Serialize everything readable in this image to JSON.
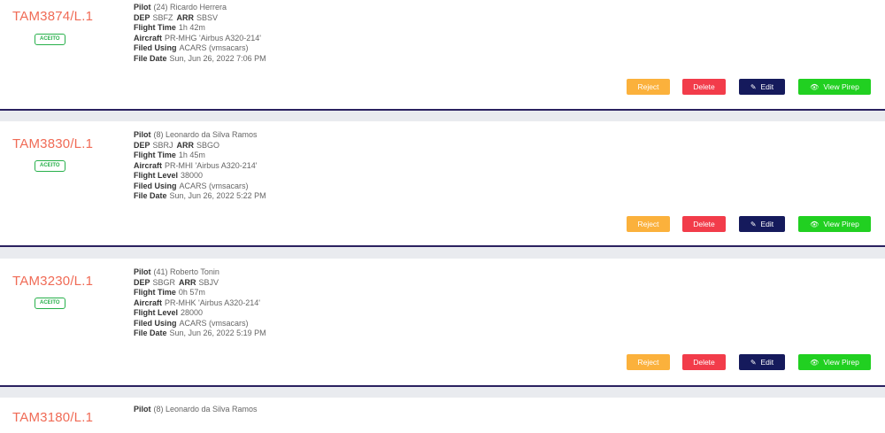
{
  "pireps": [
    {
      "flight_id": "TAM3874/L.1",
      "status": "ACEITO",
      "pilot_label": "Pilot",
      "pilot": "(24) Ricardo Herrera",
      "dep_label": "DEP",
      "dep": "SBFZ",
      "arr_label": "ARR",
      "arr": "SBSV",
      "flight_time_label": "Flight Time",
      "flight_time": "1h 42m",
      "aircraft_label": "Aircraft",
      "aircraft": "PR-MHG 'Airbus A320-214'",
      "filed_using_label": "Filed Using",
      "filed_using": "ACARS (vmsacars)",
      "file_date_label": "File Date",
      "file_date": "Sun, Jun 26, 2022 7:06 PM"
    },
    {
      "flight_id": "TAM3830/L.1",
      "status": "ACEITO",
      "pilot_label": "Pilot",
      "pilot": "(8) Leonardo da Silva Ramos",
      "dep_label": "DEP",
      "dep": "SBRJ",
      "arr_label": "ARR",
      "arr": "SBGO",
      "flight_time_label": "Flight Time",
      "flight_time": "1h 45m",
      "aircraft_label": "Aircraft",
      "aircraft": "PR-MHI 'Airbus A320-214'",
      "flight_level_label": "Flight Level",
      "flight_level": "38000",
      "filed_using_label": "Filed Using",
      "filed_using": "ACARS (vmsacars)",
      "file_date_label": "File Date",
      "file_date": "Sun, Jun 26, 2022 5:22 PM"
    },
    {
      "flight_id": "TAM3230/L.1",
      "status": "ACEITO",
      "pilot_label": "Pilot",
      "pilot": "(41) Roberto Tonin",
      "dep_label": "DEP",
      "dep": "SBGR",
      "arr_label": "ARR",
      "arr": "SBJV",
      "flight_time_label": "Flight Time",
      "flight_time": "0h 57m",
      "aircraft_label": "Aircraft",
      "aircraft": "PR-MHK 'Airbus A320-214'",
      "flight_level_label": "Flight Level",
      "flight_level": "28000",
      "filed_using_label": "Filed Using",
      "filed_using": "ACARS (vmsacars)",
      "file_date_label": "File Date",
      "file_date": "Sun, Jun 26, 2022 5:19 PM"
    },
    {
      "flight_id": "TAM3180/L.1",
      "pilot_label": "Pilot",
      "pilot": "(8) Leonardo da Silva Ramos"
    }
  ],
  "actions": {
    "reject": "Reject",
    "delete": "Delete",
    "edit": "Edit",
    "view": "View Pirep"
  },
  "colors": {
    "flight_id": "#f06b56",
    "accepted": "#27b04a",
    "reject": "#fbb13c",
    "delete": "#f23c4a",
    "edit": "#151a5c",
    "view": "#21d021",
    "card_divider": "#2a2160"
  },
  "icons": {
    "edit": "pencil-icon",
    "view": "eye-icon"
  }
}
